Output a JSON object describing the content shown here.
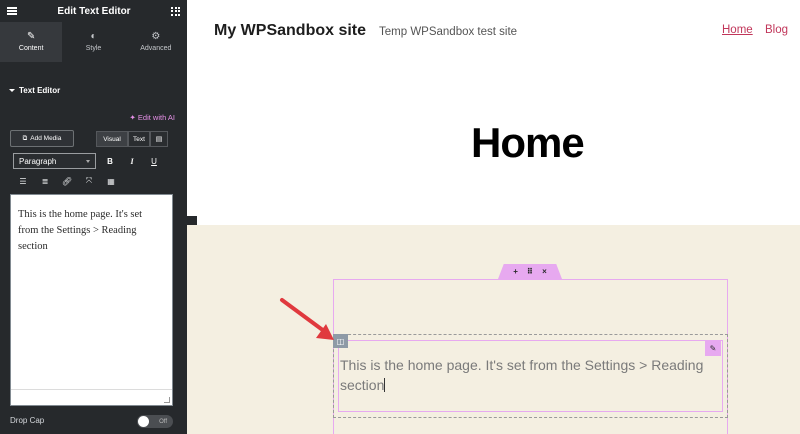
{
  "panel": {
    "title": "Edit Text Editor",
    "tabs": [
      {
        "label": "Content",
        "icon": "pencil-icon",
        "active": true
      },
      {
        "label": "Style",
        "icon": "half-circle-icon",
        "active": false
      },
      {
        "label": "Advanced",
        "icon": "gear-icon",
        "active": false
      }
    ],
    "section_title": "Text Editor",
    "edit_with_ai": "✦ Edit with AI",
    "add_media": "Add Media",
    "view_tabs": {
      "visual": "Visual",
      "text": "Text"
    },
    "format_select": "Paragraph",
    "format_buttons": {
      "bold": "B",
      "italic": "I",
      "underline": "U"
    },
    "editor_content": "This is the home page. It's set from the Settings > Reading section",
    "drop_cap_label": "Drop Cap",
    "drop_cap_toggle": "Off"
  },
  "site": {
    "title": "My WPSandbox site",
    "tagline": "Temp WPSandbox test site",
    "nav": [
      "Home",
      "Blog"
    ],
    "heading": "Home",
    "widget_text": "This is the home page. It's set from the Settings > Reading section"
  },
  "colors": {
    "panel_bg": "#26292c",
    "accent_pink": "#e7a9f0",
    "nav_link": "#c1365a",
    "content_bg": "#f4efe1",
    "arrow": "#e0393e"
  }
}
